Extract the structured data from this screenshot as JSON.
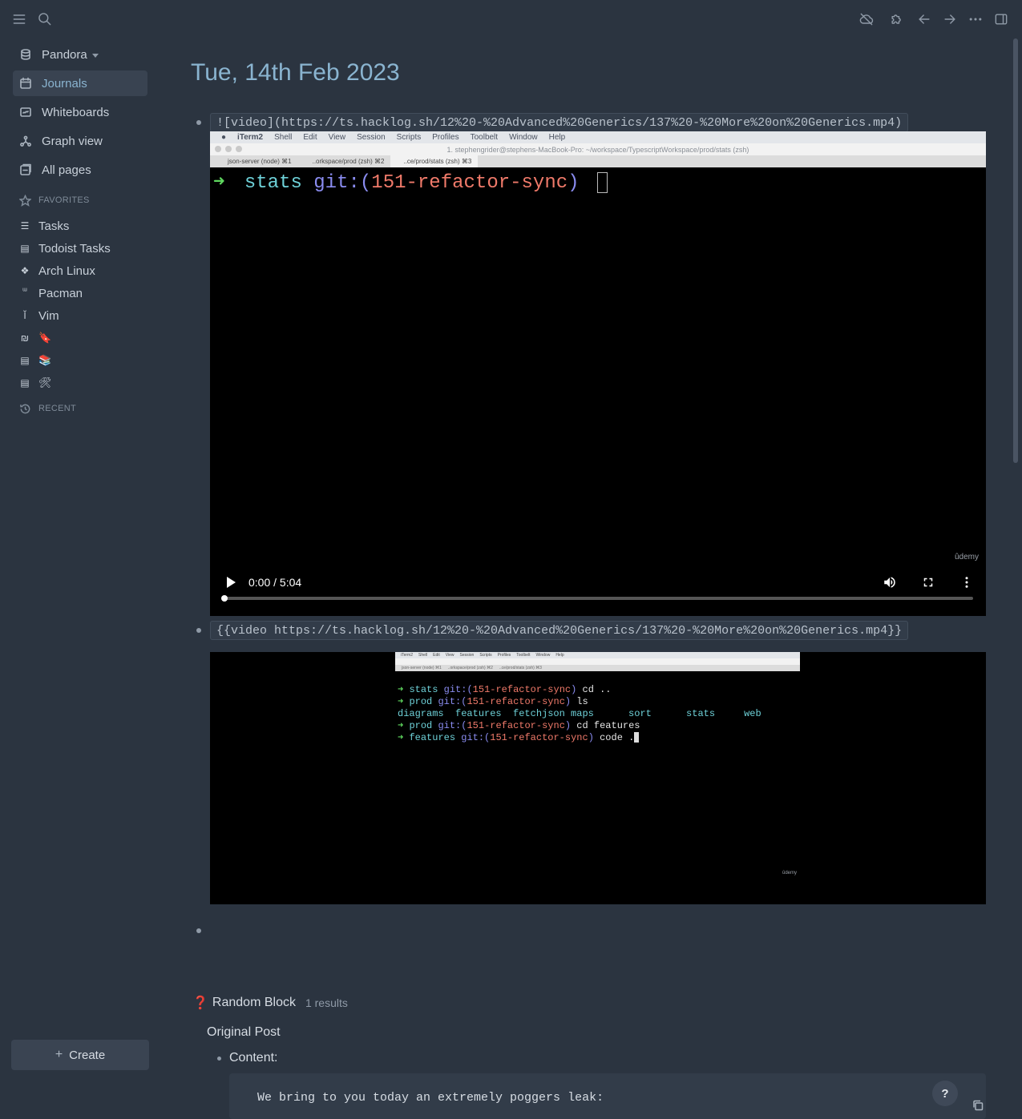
{
  "sidebar": {
    "graph_name": "Pandora",
    "nav": [
      {
        "label": "Journals",
        "icon": "calendar-icon",
        "active": true
      },
      {
        "label": "Whiteboards",
        "icon": "whiteboard-icon"
      },
      {
        "label": "Graph view",
        "icon": "graph-icon"
      },
      {
        "label": "All pages",
        "icon": "pages-icon"
      }
    ],
    "favorites_title": "FAVORITES",
    "favorites": [
      {
        "label": "Tasks",
        "glyph": "☰"
      },
      {
        "label": "Todoist Tasks",
        "glyph": "▤"
      },
      {
        "label": "Arch Linux",
        "glyph": "❖"
      },
      {
        "label": "Pacman",
        "glyph": "ᵚ"
      },
      {
        "label": "Vim",
        "glyph": "Ĭ"
      },
      {
        "label": "🔖",
        "glyph": "₪"
      },
      {
        "label": "📚",
        "glyph": "▤"
      },
      {
        "label": "🛠",
        "glyph": "▤"
      }
    ],
    "recent_title": "RECENT",
    "create_label": "Create"
  },
  "journal": {
    "title": "Tue, 14th Feb 2023",
    "block1_code": "![video](https://ts.hacklog.sh/12%20-%20Advanced%20Generics/137%20-%20More%20on%20Generics.mp4)",
    "block2_code": "{{video https://ts.hacklog.sh/12%20-%20Advanced%20Generics/137%20-%20More%20on%20Generics.mp4}}"
  },
  "video1": {
    "menubar": [
      "iTerm2",
      "Shell",
      "Edit",
      "View",
      "Session",
      "Scripts",
      "Profiles",
      "Toolbelt",
      "Window",
      "Help"
    ],
    "window_title": "1. stephengrider@stephens-MacBook-Pro: ~/workspace/TypescriptWorkspace/prod/stats (zsh)",
    "tabs": [
      "json-server (node)   ⌘1",
      "..orkspace/prod (zsh)   ⌘2",
      "..ce/prod/stats (zsh)   ⌘3"
    ],
    "prompt_arrow": "➜",
    "prompt_dir": "stats",
    "prompt_git": "git:(",
    "prompt_branch": "151-refactor-sync",
    "prompt_git_close": ")",
    "watermark": "ûdemy",
    "time": "0:00 / 5:04",
    "progress": 0
  },
  "video2": {
    "watermark": "ûdemy",
    "lines": [
      {
        "arrow": "➜",
        "dir": "stats",
        "branch": "151-refactor-sync",
        "cmd": " cd .."
      },
      {
        "arrow": "➜",
        "dir": "prod",
        "branch": "151-refactor-sync",
        "cmd": " ls"
      },
      {
        "ls": "diagrams  features  fetchjson maps      sort      stats     web"
      },
      {
        "arrow": "➜",
        "dir": "prod",
        "branch": "151-refactor-sync",
        "cmd": " cd features"
      },
      {
        "arrow": "➜",
        "dir": "features",
        "branch": "151-refactor-sync",
        "cmd": " code ."
      }
    ]
  },
  "query": {
    "title": "Random Block",
    "count": "1 results",
    "page": "Original Post",
    "property": "Content:",
    "code": "We bring to you today an extremely poggers leak:"
  },
  "help_label": "?"
}
